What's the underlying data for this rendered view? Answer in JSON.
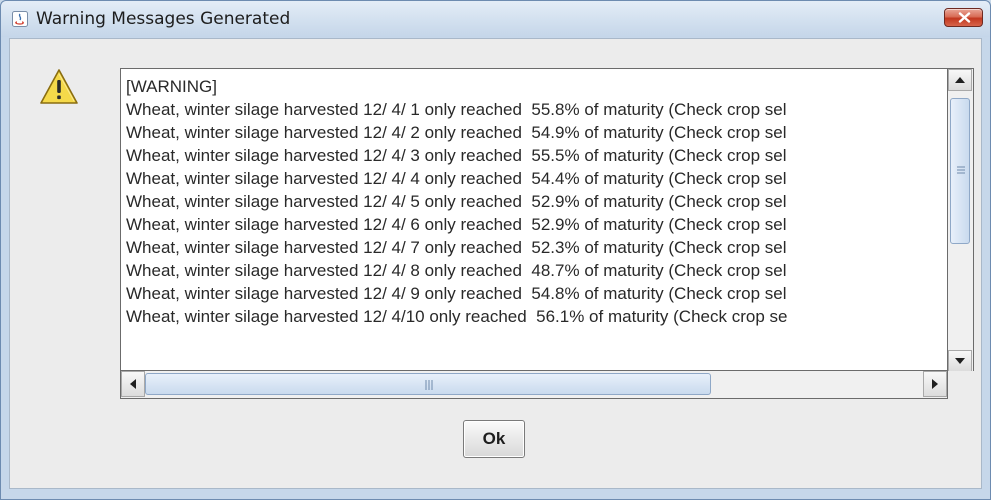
{
  "window": {
    "title": "Warning Messages Generated"
  },
  "message_lines": [
    "[WARNING]",
    "Wheat, winter silage harvested 12/ 4/ 1 only reached  55.8% of maturity (Check crop sel",
    "Wheat, winter silage harvested 12/ 4/ 2 only reached  54.9% of maturity (Check crop sel",
    "Wheat, winter silage harvested 12/ 4/ 3 only reached  55.5% of maturity (Check crop sel",
    "Wheat, winter silage harvested 12/ 4/ 4 only reached  54.4% of maturity (Check crop sel",
    "Wheat, winter silage harvested 12/ 4/ 5 only reached  52.9% of maturity (Check crop sel",
    "Wheat, winter silage harvested 12/ 4/ 6 only reached  52.9% of maturity (Check crop sel",
    "Wheat, winter silage harvested 12/ 4/ 7 only reached  52.3% of maturity (Check crop sel",
    "Wheat, winter silage harvested 12/ 4/ 8 only reached  48.7% of maturity (Check crop sel",
    "Wheat, winter silage harvested 12/ 4/ 9 only reached  54.8% of maturity (Check crop sel",
    "Wheat, winter silage harvested 12/ 4/10 only reached  56.1% of maturity (Check crop se"
  ],
  "buttons": {
    "ok_label": "Ok"
  },
  "icons": {
    "app": "java-app-icon",
    "close": "close-icon",
    "warning": "warning-icon"
  },
  "colors": {
    "close_button": "#d05a42",
    "warning_fill": "#f5d94a",
    "text": "#292929"
  }
}
